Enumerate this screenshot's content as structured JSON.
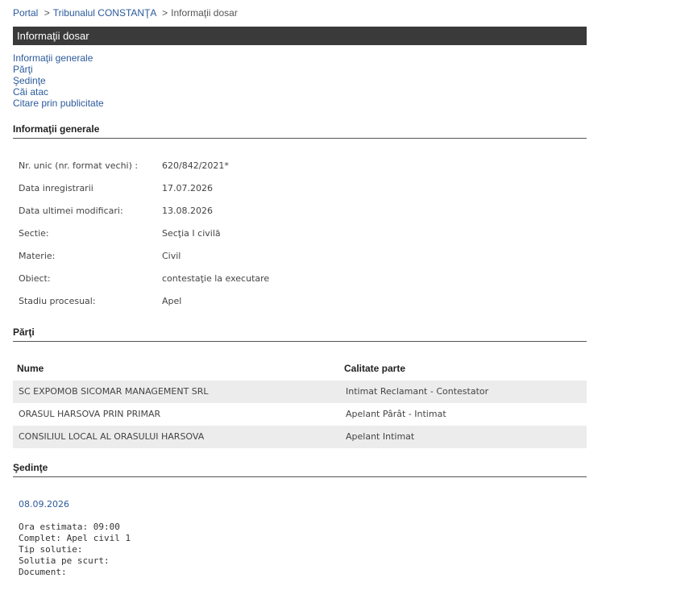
{
  "breadcrumb": {
    "portal": "Portal",
    "sep1": ">",
    "court": "Tribunalul CONSTANŢA",
    "sep2": ">",
    "current": "Informaţii dosar"
  },
  "header": {
    "title": "Informaţii dosar"
  },
  "nav": [
    "Informaţii generale",
    "Părţi",
    "Şedinţe",
    "Căi atac",
    "Citare prin publicitate"
  ],
  "general": {
    "title": "Informaţii generale",
    "rows": [
      {
        "label": "Nr. unic (nr. format vechi) :",
        "value": "620/842/2021*"
      },
      {
        "label": "Data inregistrarii",
        "value": "17.07.2026"
      },
      {
        "label": "Data ultimei modificari:",
        "value": "13.08.2026"
      },
      {
        "label": "Sectie:",
        "value": "Secţia I civilă"
      },
      {
        "label": "Materie:",
        "value": "Civil"
      },
      {
        "label": "Obiect:",
        "value": "contestaţie la executare"
      },
      {
        "label": "Stadiu procesual:",
        "value": "Apel"
      }
    ]
  },
  "parti": {
    "title": "Părţi",
    "col_name": "Nume",
    "col_role": "Calitate parte",
    "rows": [
      {
        "name": "SC EXPOMOB SICOMAR MANAGEMENT SRL",
        "role": "Intimat Reclamant - Contestator"
      },
      {
        "name": "ORASUL HARSOVA PRIN PRIMAR",
        "role": "Apelant Pârât - Intimat"
      },
      {
        "name": "CONSILIUL LOCAL AL ORASULUI HARSOVA",
        "role": "Apelant Intimat"
      }
    ]
  },
  "sedinte": {
    "title": "Şedinţe",
    "date": "08.09.2026",
    "details": [
      "Ora estimata: 09:00",
      "Complet: Apel civil 1",
      "Tip solutie:",
      "Solutia pe scurt:",
      "Document:"
    ]
  }
}
